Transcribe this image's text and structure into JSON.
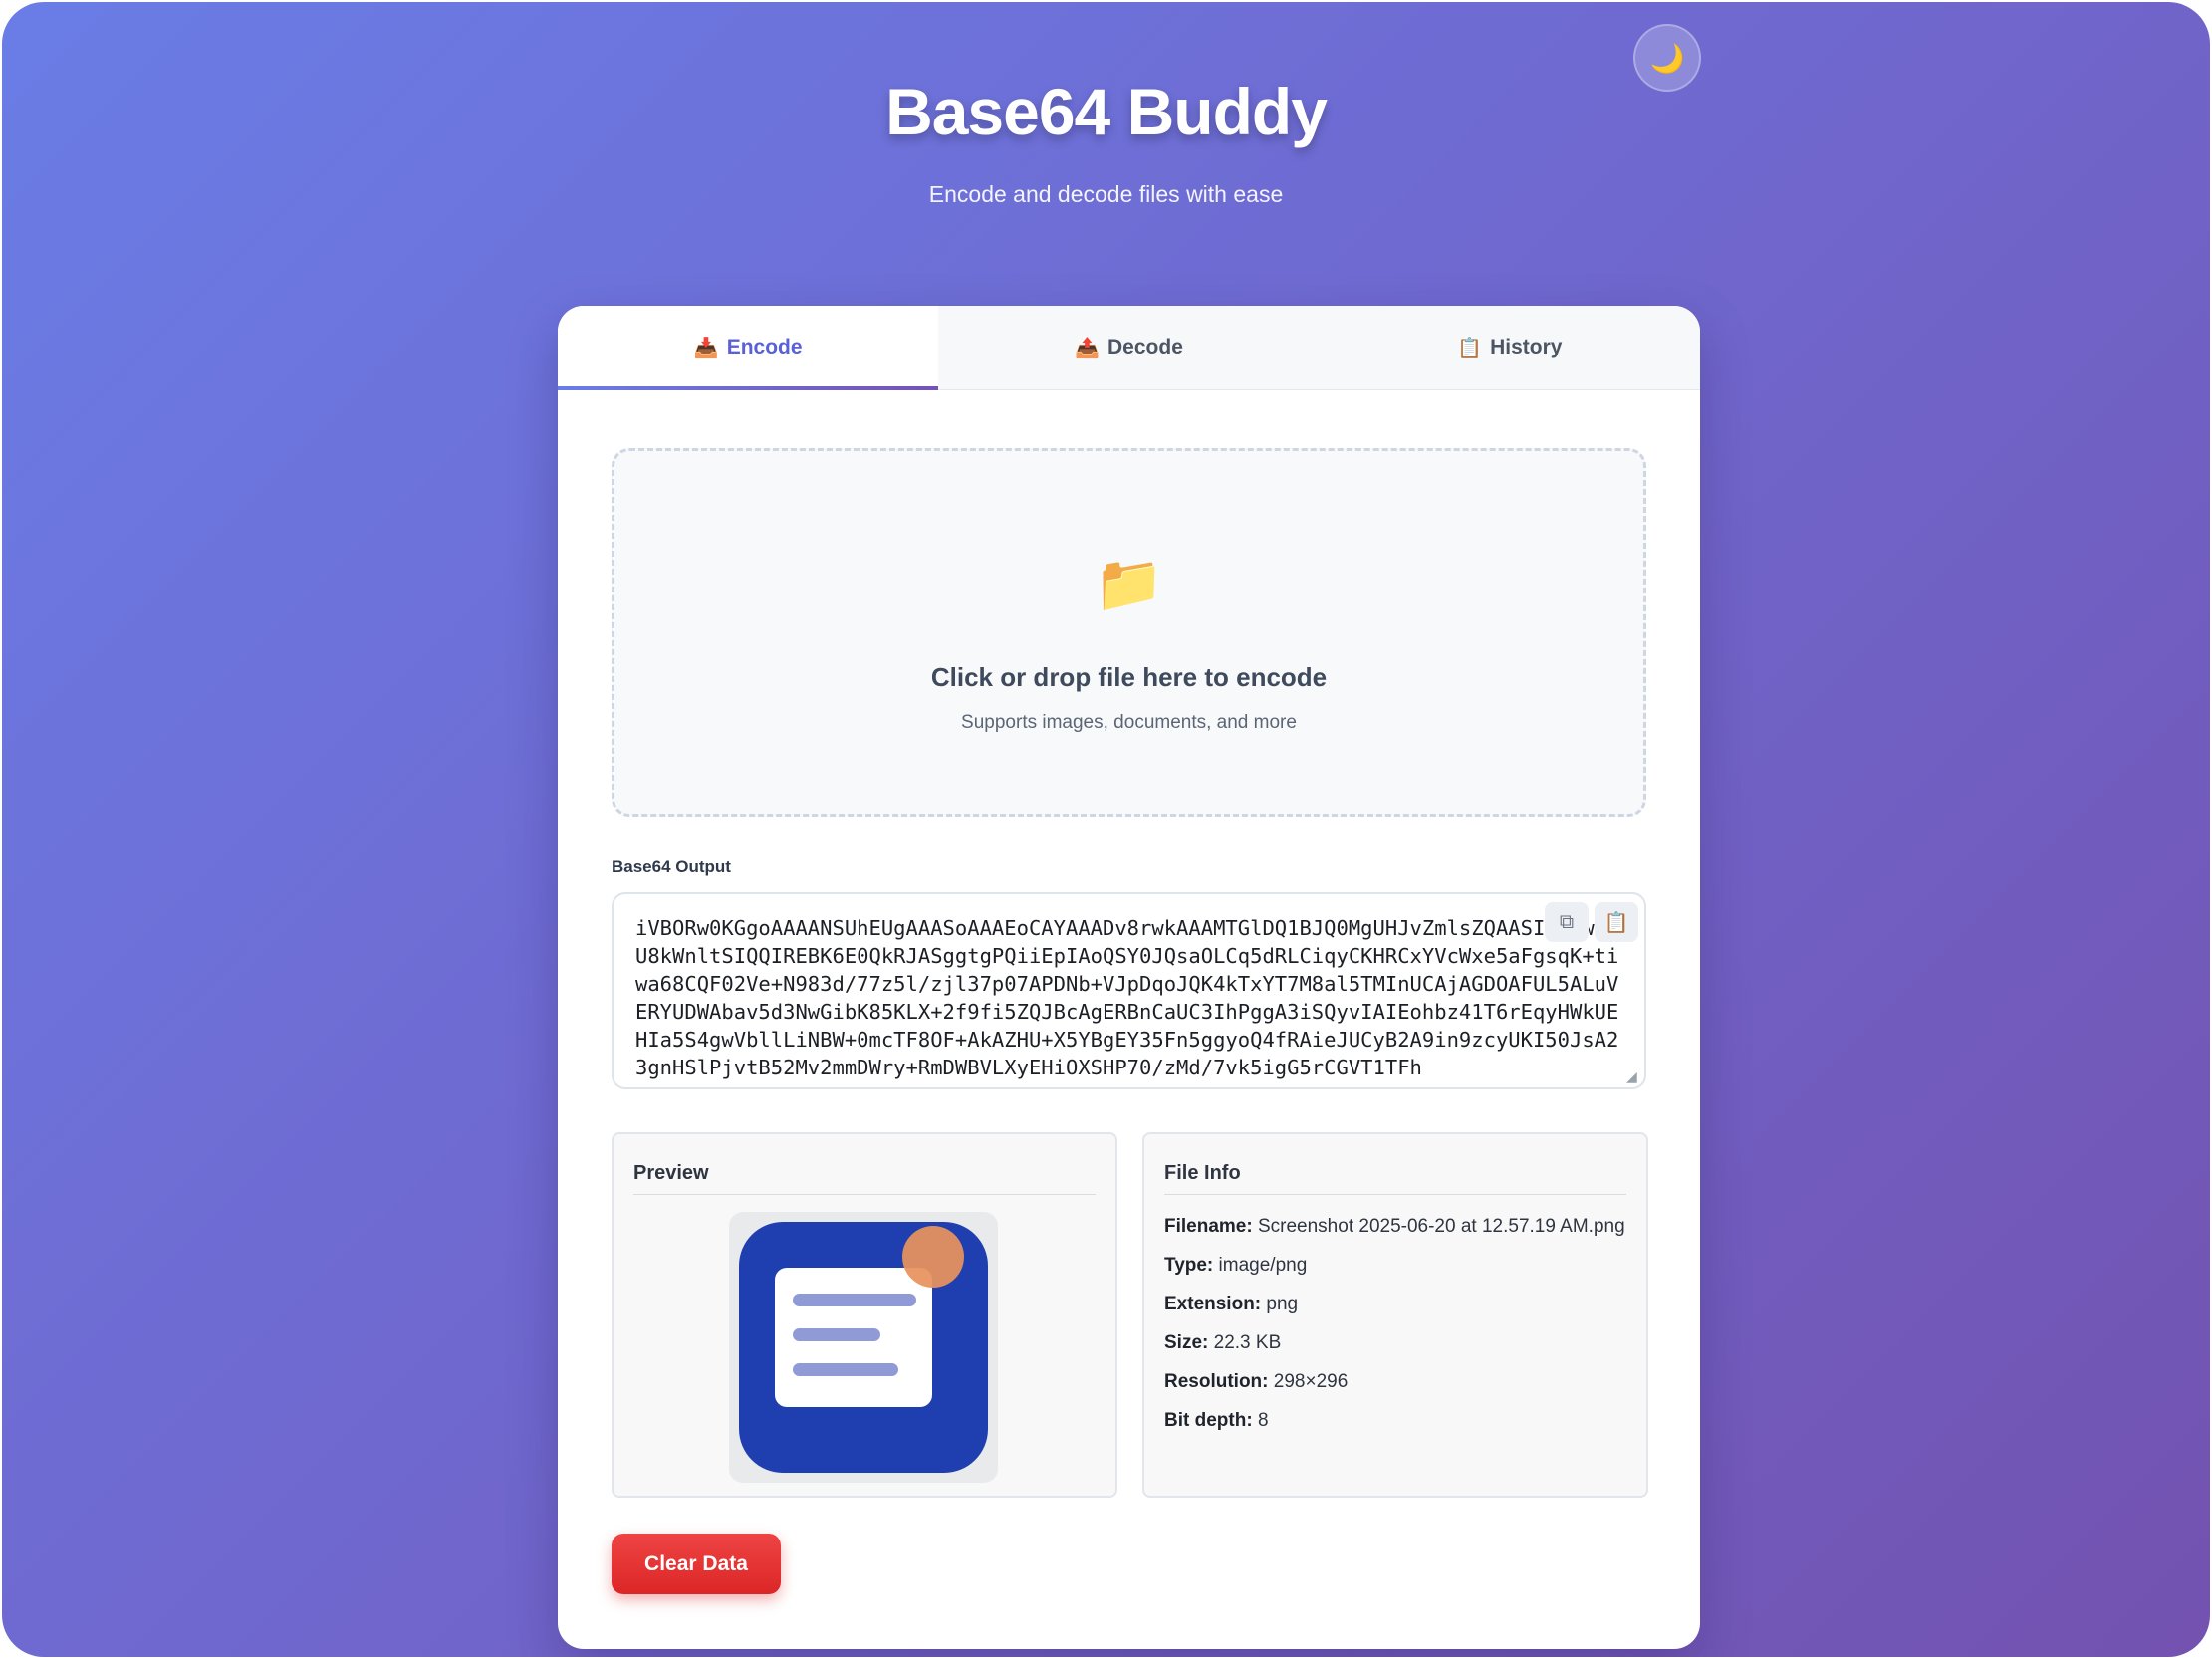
{
  "header": {
    "title": "Base64 Buddy",
    "subtitle": "Encode and decode files with ease",
    "theme_toggle_icon": "moon-icon",
    "theme_toggle_glyph": "🌙"
  },
  "tabs": [
    {
      "label": "Encode",
      "icon": "inbox-tray-icon",
      "glyph": "📥",
      "active": true
    },
    {
      "label": "Decode",
      "icon": "outbox-tray-icon",
      "glyph": "📤",
      "active": false
    },
    {
      "label": "History",
      "icon": "clipboard-icon",
      "glyph": "📋",
      "active": false
    }
  ],
  "dropzone": {
    "icon": "folder-icon",
    "glyph": "📁",
    "title": "Click or drop file here to encode",
    "subtitle": "Supports images, documents, and more"
  },
  "output": {
    "label": "Base64 Output",
    "value": "iVBORw0KGgoAAAANSUhEUgAAASoAAAEoCAYAAADv8rwkAAAMTGlDQ1BJQ0MgUHJvZmlsZQAASImVVwdYU8kWnltSIQQIREBK6E0QkRJASggtgPQiiEpIAoQSY0JQsaOLCq5dRLCiqyCKHRCxYVcWxe5aFgsqK+tiwa68CQF02Ve+N983d/77z5l/zjl37p07APDNb+VJpDqoJQK4kTxYT7M8al5TMInUCAjAGDOAFUL5ALuVERYUDWAbav5d3NwGibK85KLX+2f9fi5ZQJBcAgERBnCaUC3IhPggA3iSQyvIAIEohbz41T6rEqyHWkUEHIa5S4gwVbllLiNBW+0mcTF8OF+AkAZHU+X5YBgEY35Fn5ggyoQ4fRAieJUCyB2A9in9zcyUKI50JsA23gnHSlPjvtB52Mv2mmDWry+RmDWBVLXyEHiOXSHP70/zMd/7vk5igG5rCGVT1TFh"
  },
  "output_actions": [
    {
      "name": "copy-icon",
      "glyph": "⧉"
    },
    {
      "name": "clipboard-icon",
      "glyph": "📋"
    }
  ],
  "preview": {
    "title": "Preview",
    "image": {
      "icon": "document-app-icon",
      "background": "#1f3fb0",
      "card": "#ffffff",
      "line_color": "#8f9ad6",
      "badge_color": "#e8925c"
    }
  },
  "file_info": {
    "title": "File Info",
    "rows": [
      {
        "key": "Filename:",
        "value": "Screenshot 2025-06-20 at 12.57.19 AM.png"
      },
      {
        "key": "Type:",
        "value": "image/png"
      },
      {
        "key": "Extension:",
        "value": "png"
      },
      {
        "key": "Size:",
        "value": "22.3 KB"
      },
      {
        "key": "Resolution:",
        "value": "298×296"
      },
      {
        "key": "Bit depth:",
        "value": "8"
      }
    ]
  },
  "actions": {
    "clear_label": "Clear Data"
  },
  "colors": {
    "accent": "#5a61d8",
    "gradient_start": "#6a7de6",
    "gradient_end": "#7552b6",
    "danger": "#ef4444"
  }
}
